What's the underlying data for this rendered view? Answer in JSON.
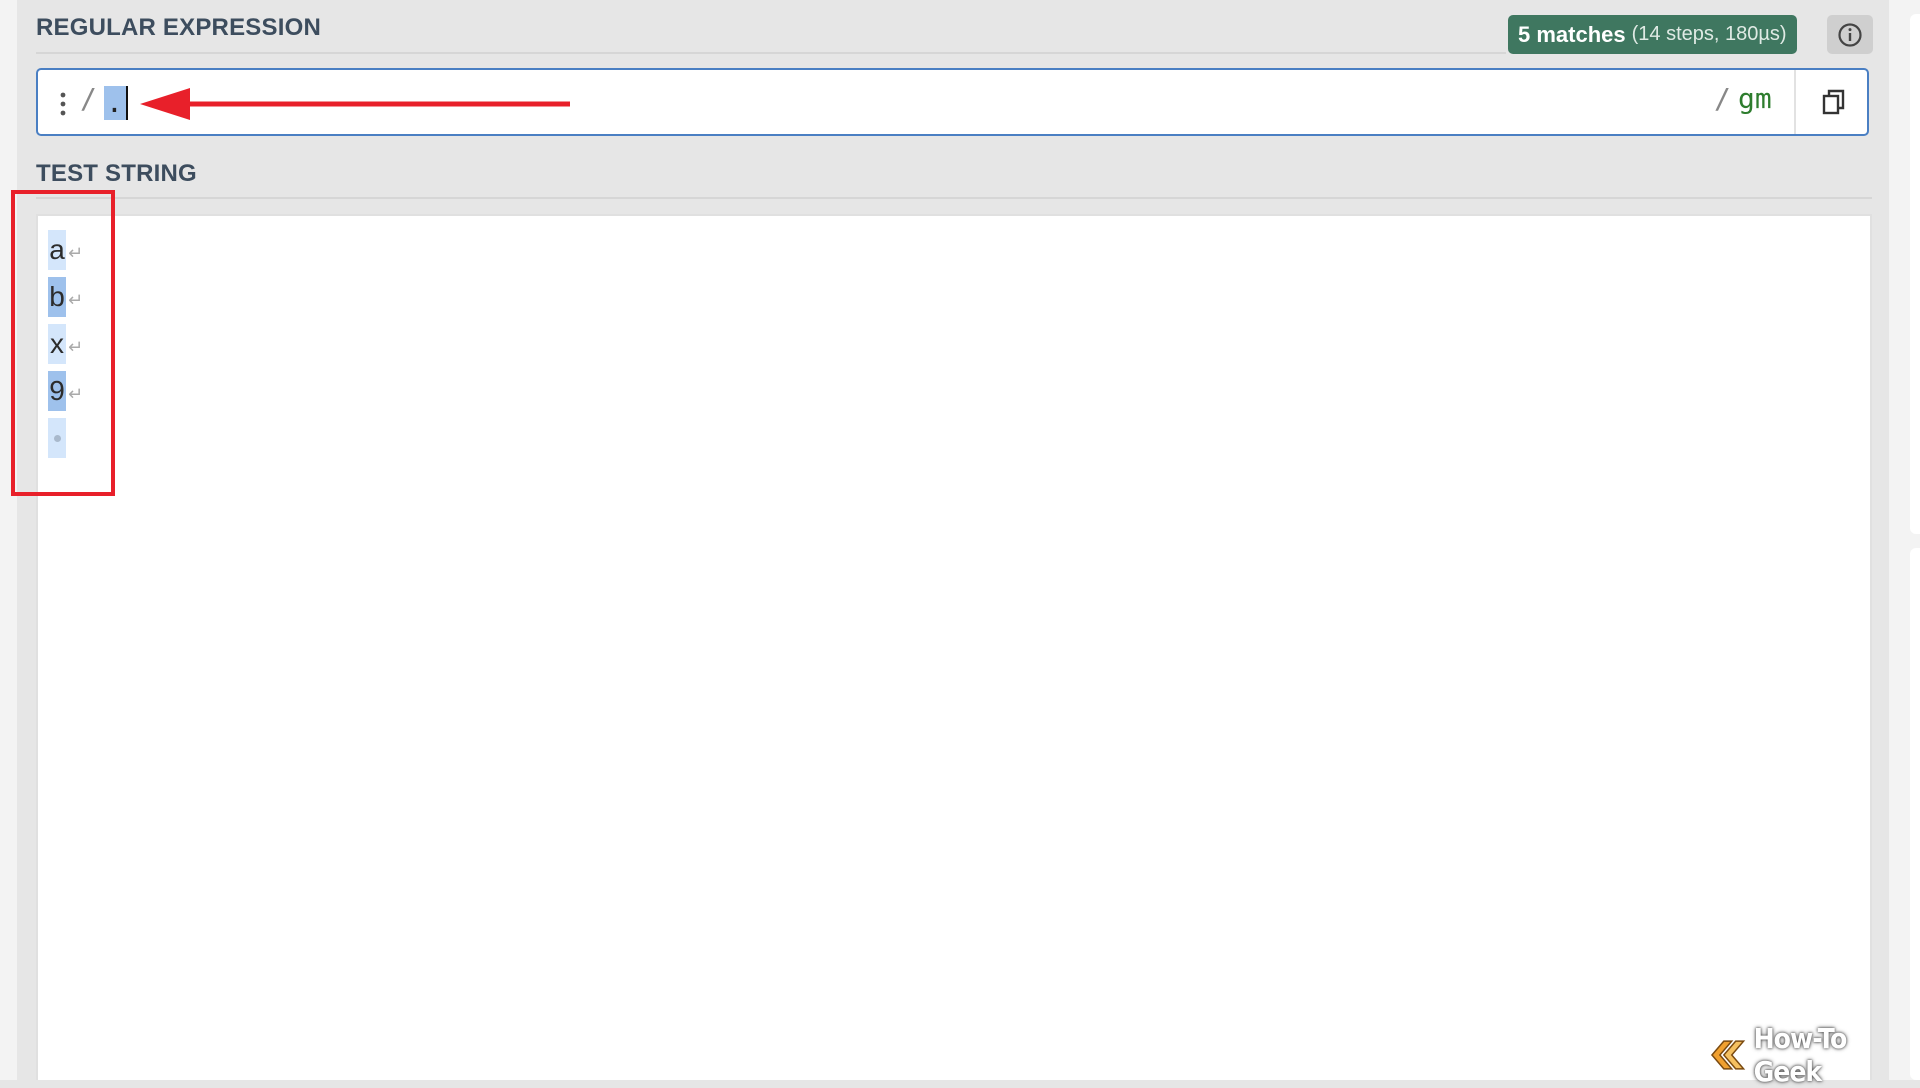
{
  "regex_section": {
    "title": "REGULAR EXPRESSION",
    "match_count": "5 matches",
    "match_detail": "(14 steps, 180µs)",
    "open_delimiter": "/",
    "pattern": ".",
    "close_delimiter": "/",
    "flags": "gm"
  },
  "test_section": {
    "title": "TEST STRING",
    "lines": [
      {
        "text": "a",
        "match_tone": "light"
      },
      {
        "text": "b",
        "match_tone": "dark"
      },
      {
        "text": "x",
        "match_tone": "light"
      },
      {
        "text": "9",
        "match_tone": "dark"
      }
    ],
    "newline_glyph": "↵"
  },
  "watermark": {
    "text": "How-To Geek"
  },
  "icons": {
    "drag": "drag-handle-icon",
    "info": "info-icon",
    "copy": "copy-icon",
    "annotation": "red-arrow-annotation",
    "logo": "how-to-geek-logo"
  },
  "colors": {
    "badge_bg": "#3f7760",
    "regex_border": "#4a7fc3",
    "flags": "#2e7d2e",
    "match_dark": "#9ec1ec",
    "match_light": "#d4e6fb",
    "annotation_red": "#e8202a"
  }
}
